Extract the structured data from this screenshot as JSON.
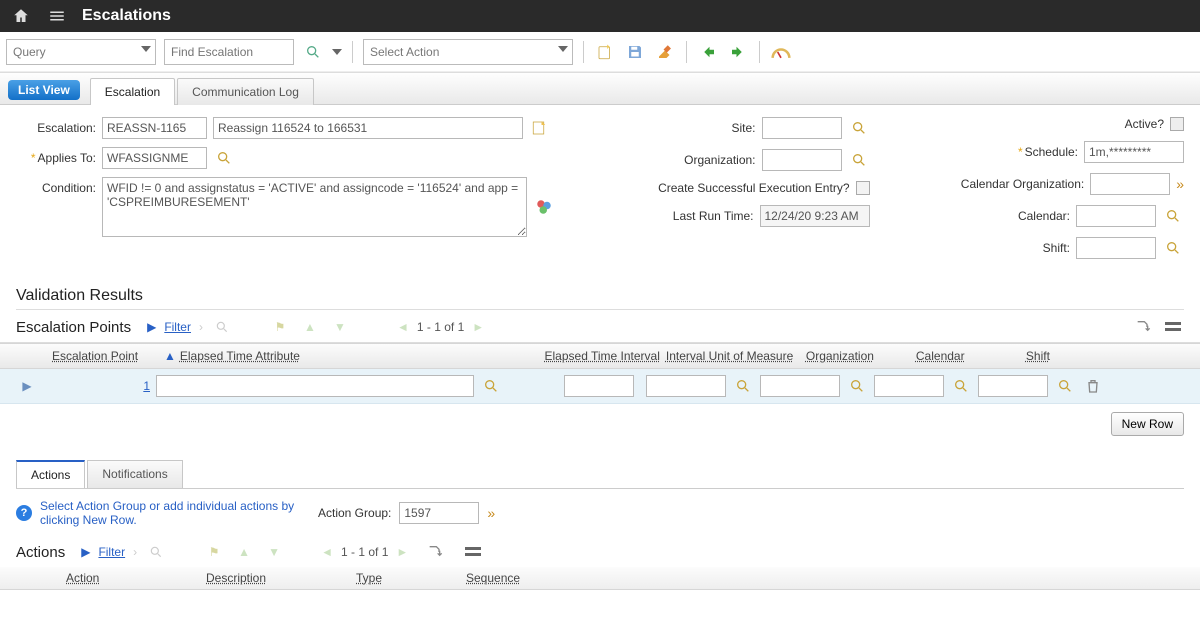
{
  "app": {
    "title": "Escalations"
  },
  "toolbar": {
    "query_label": "Query",
    "find_placeholder": "Find Escalation",
    "action_label": "Select Action"
  },
  "tabs": {
    "list_view": "List View",
    "escalation": "Escalation",
    "comm_log": "Communication Log"
  },
  "form": {
    "escalation_label": "Escalation:",
    "escalation_id": "REASSN-1165",
    "escalation_desc": "Reassign 116524 to 166531",
    "applies_to_label": "Applies To:",
    "applies_to": "WFASSIGNME",
    "condition_label": "Condition:",
    "condition": "WFID != 0 and assignstatus = 'ACTIVE' and assigncode = '116524' and app = 'CSPREIMBURESEMENT'",
    "site_label": "Site:",
    "org_label": "Organization:",
    "cse_label": "Create Successful Execution Entry?",
    "last_run_label": "Last Run Time:",
    "last_run": "12/24/20 9:23 AM",
    "active_label": "Active?",
    "schedule_label": "Schedule:",
    "schedule": "1m,*********",
    "cal_org_label": "Calendar Organization:",
    "calendar_label": "Calendar:",
    "shift_label": "Shift:"
  },
  "validation": {
    "heading": "Validation Results"
  },
  "points": {
    "heading": "Escalation Points",
    "filter": "Filter",
    "pager": "1 - 1 of 1",
    "cols": {
      "point": "Escalation Point",
      "eta": "Elapsed Time Attribute",
      "eti": "Elapsed Time Interval",
      "uom": "Interval Unit of Measure",
      "org": "Organization",
      "cal": "Calendar",
      "shift": "Shift"
    },
    "row1": {
      "point": "1"
    },
    "new_row": "New Row"
  },
  "subtabs": {
    "actions": "Actions",
    "notifications": "Notifications"
  },
  "hint": {
    "text": "Select Action Group or add individual actions by clicking New Row.",
    "group_label": "Action Group:",
    "group_value": "1597"
  },
  "actions": {
    "heading": "Actions",
    "filter": "Filter",
    "pager": "1 - 1 of 1",
    "cols": {
      "action": "Action",
      "desc": "Description",
      "type": "Type",
      "seq": "Sequence"
    }
  }
}
